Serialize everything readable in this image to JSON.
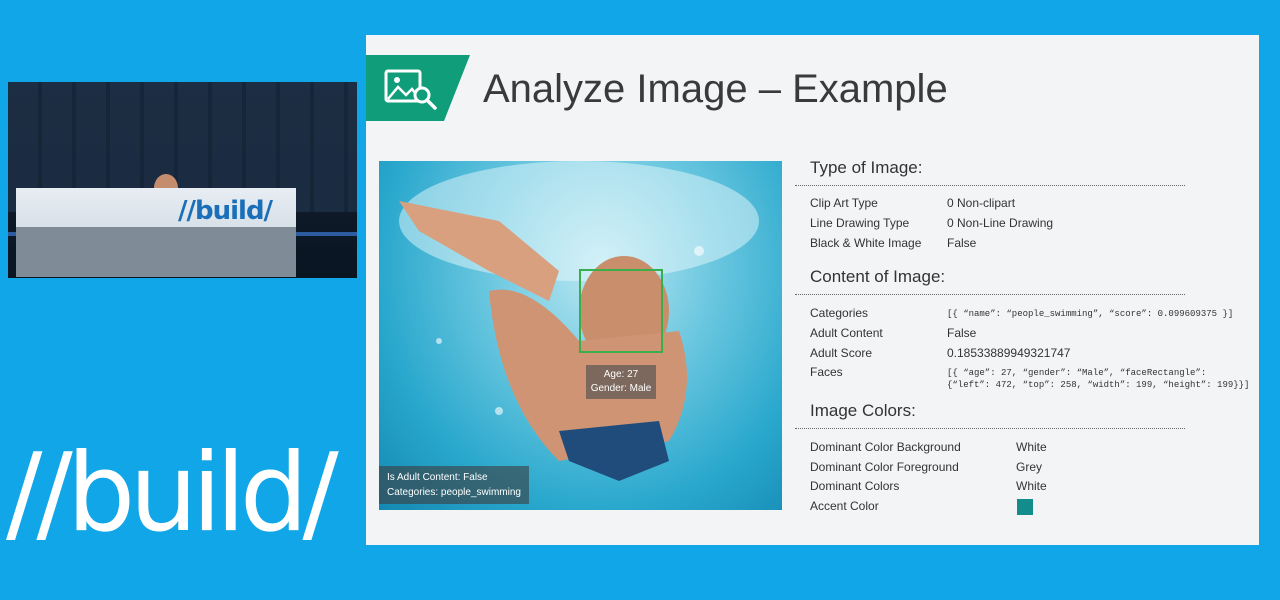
{
  "video": {
    "podium_logo": "//build/"
  },
  "brand": {
    "logo": "//build/"
  },
  "slide": {
    "title": "Analyze Image – Example",
    "icon": "image-search-icon",
    "accent_color": "#0f9d7a",
    "photo": {
      "face_label_age": "Age: 27",
      "face_label_gender": "Gender: Male",
      "caption_adult": "Is Adult Content: False",
      "caption_categories": "Categories: people_swimming"
    },
    "type_of_image": {
      "heading": "Type of Image:",
      "rows": [
        {
          "label": "Clip Art Type",
          "value": "0 Non-clipart"
        },
        {
          "label": "Line Drawing Type",
          "value": "0 Non-Line Drawing"
        },
        {
          "label": "Black & White Image",
          "value": "False"
        }
      ]
    },
    "content_of_image": {
      "heading": "Content of Image:",
      "rows": [
        {
          "label": "Categories",
          "value": "[{ “name”: “people_swimming”, “score”: 0.099609375 }]"
        },
        {
          "label": "Adult Content",
          "value": "False"
        },
        {
          "label": "Adult Score",
          "value": "0.18533889949321747"
        },
        {
          "label": "Faces",
          "value_line1": "[{ “age”: 27, “gender”: “Male”, “faceRectangle”:",
          "value_line2": "{“left”: 472, “top”: 258, “width”: 199, “height”: 199}}]"
        }
      ]
    },
    "image_colors": {
      "heading": "Image Colors:",
      "rows": [
        {
          "label": "Dominant Color Background",
          "value": "White"
        },
        {
          "label": "Dominant Color Foreground",
          "value": "Grey"
        },
        {
          "label": "Dominant Colors",
          "value": "White"
        },
        {
          "label": "Accent Color",
          "swatch": "#138c8c"
        }
      ]
    }
  }
}
